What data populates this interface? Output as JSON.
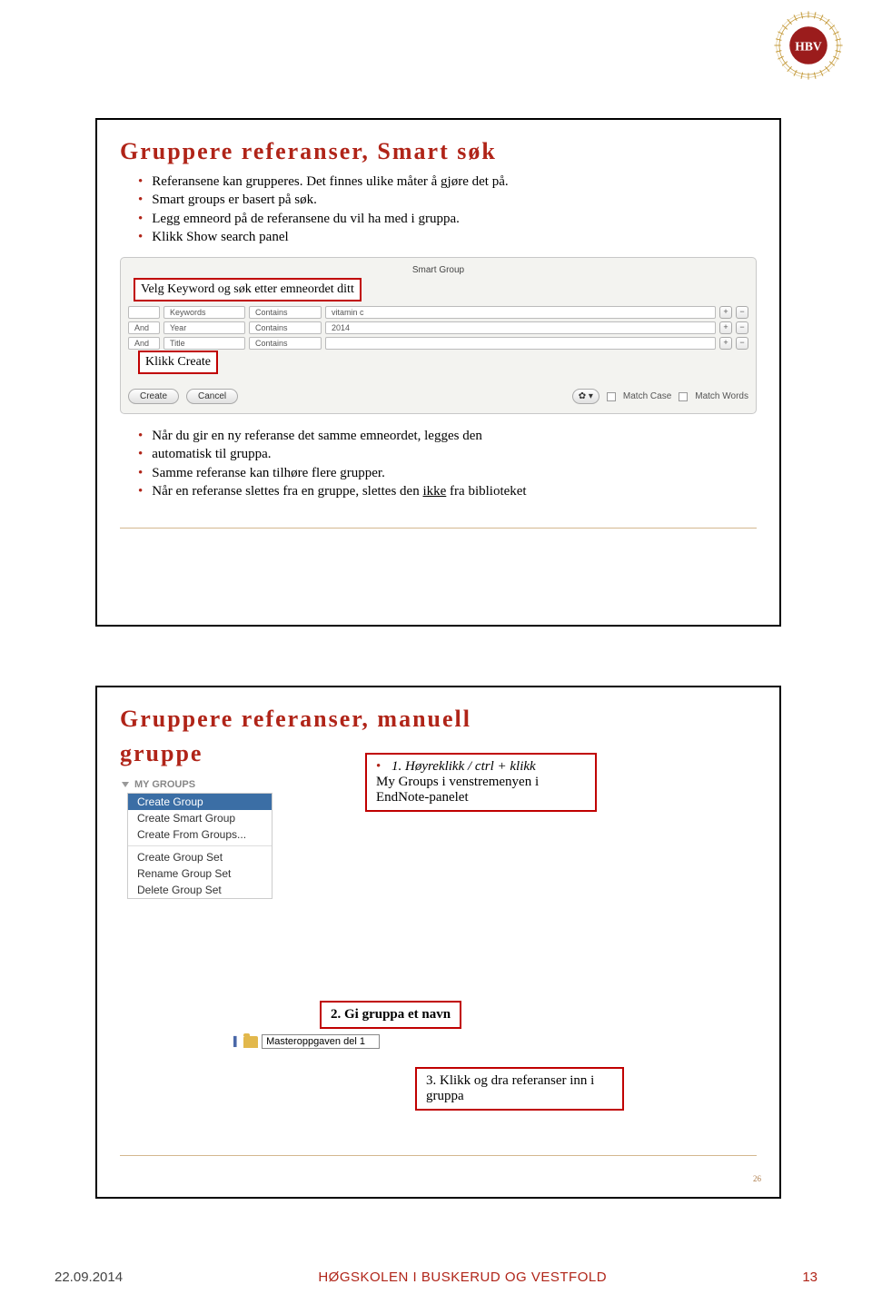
{
  "logo": {
    "letters": "HBV"
  },
  "slide1": {
    "title": "Gruppere referanser, Smart søk",
    "top_bullets": [
      "Referansene kan grupperes. Det finnes ulike måter å gjøre det på.",
      "Smart groups er basert på søk.",
      "Legg emneord på de referansene du vil ha med i gruppa.",
      "Klikk Show search panel"
    ],
    "smart_group": {
      "panel_title": "Smart Group",
      "rows": [
        {
          "and": "",
          "field": "Keywords",
          "op": "Contains",
          "val": "vitamin c"
        },
        {
          "and": "And",
          "field": "Year",
          "op": "Contains",
          "val": "2014"
        },
        {
          "and": "And",
          "field": "Title",
          "op": "Contains",
          "val": ""
        }
      ],
      "create_btn": "Create",
      "cancel_btn": "Cancel",
      "match_case": "Match Case",
      "match_words": "Match Words"
    },
    "label_keyword": "Velg Keyword og søk etter emneordet ditt",
    "label_create": "Klikk Create",
    "bottom_bullets": [
      "Når du gir en ny referanse det samme emneordet, legges den",
      "automatisk til gruppa.",
      "Samme referanse kan tilhøre flere grupper.",
      "Når en referanse slettes fra en gruppe, slettes den ikke fra biblioteket"
    ],
    "underline_word": "ikke"
  },
  "slide2": {
    "title_l1": "Gruppere referanser, manuell",
    "title_l2": "gruppe",
    "my_groups_header": "MY GROUPS",
    "menu_items": {
      "sel": "Create Group",
      "a": "Create Smart Group",
      "b": "Create From Groups...",
      "c": "Create Group Set",
      "d": "Rename Group Set",
      "e": "Delete Group Set"
    },
    "step1_l1": "1. Høyreklikk / ctrl + klikk",
    "step1_l2": "My Groups i venstremenyen i EndNote-panelet",
    "step2": "2. Gi gruppa et navn",
    "folder_value": "Masteroppgaven del 1",
    "step3": "3. Klikk og dra referanser inn i gruppa",
    "page_num": "26"
  },
  "footer": {
    "date": "22.09.2014",
    "org": "HØGSKOLEN I BUSKERUD OG VESTFOLD",
    "page": "13"
  }
}
